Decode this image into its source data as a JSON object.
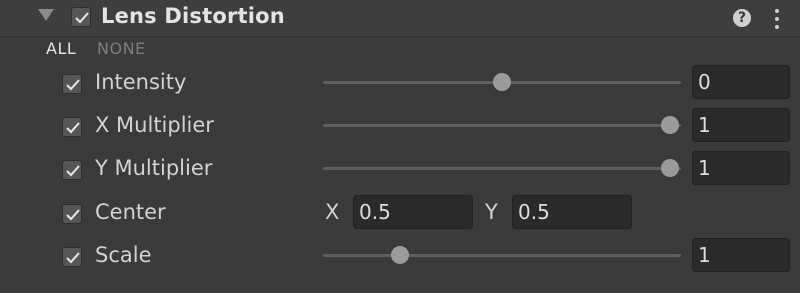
{
  "header": {
    "title": "Lens Distortion",
    "enabled": true,
    "help_icon": "?"
  },
  "toggles": {
    "all_label": "ALL",
    "none_label": "NONE"
  },
  "rows": [
    {
      "label": "Intensity",
      "checked": true,
      "value": "0",
      "slider_fraction": 0.5
    },
    {
      "label": "X Multiplier",
      "checked": true,
      "value": "1",
      "slider_fraction": 1.0
    },
    {
      "label": "Y Multiplier",
      "checked": true,
      "value": "1",
      "slider_fraction": 1.0
    },
    {
      "label": "Center",
      "checked": true,
      "x_label": "X",
      "x_value": "0.5",
      "y_label": "Y",
      "y_value": "0.5"
    },
    {
      "label": "Scale",
      "checked": true,
      "value": "1",
      "slider_fraction": 0.2
    }
  ]
}
